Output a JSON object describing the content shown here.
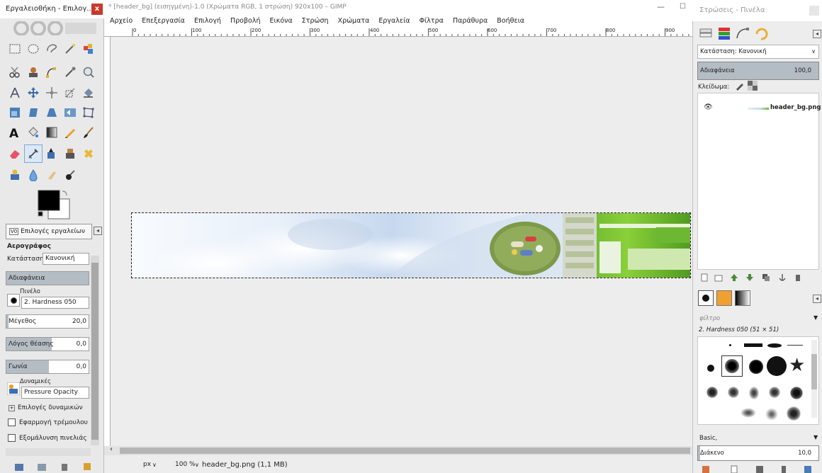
{
  "toolbox": {
    "title": "Εργαλειοθήκη - Επιλογ...",
    "close_label": "x",
    "tool_options_tab": "Επιλογές εργαλείων",
    "tool_name": "Αερογράφος",
    "mode_label": "Κατάσταση:",
    "mode_value": "Κανονική",
    "opacity_label": "Αδιαφάνεια",
    "brush_label": "Πινέλο",
    "brush_value": "2. Hardness 050",
    "size_label": "Μέγεθος",
    "size_value": "20,0",
    "aspect_label": "Λόγος θέασης",
    "aspect_value": "0,0",
    "angle_label": "Γωνία",
    "angle_value": "0,0",
    "dynamics_label": "Δυναμικές",
    "dynamics_value": "Pressure Opacity",
    "dynamics_options": "Επιλογές δυναμικών",
    "apply_jitter": "Εφαρμογή τρέμουλου",
    "smooth_stroke": "Εξομάλυνση πινελιάς"
  },
  "main": {
    "title": "* [header_bg] (εισηγμένη)-1.0 (Χρώματα RGB, 1 στρώση) 920x100 – GIMP",
    "menu": [
      "Αρχείο",
      "Επεξεργασία",
      "Επιλογή",
      "Προβολή",
      "Εικόνα",
      "Στρώση",
      "Χρώματα",
      "Εργαλεία",
      "Φίλτρα",
      "Παράθυρα",
      "Βοήθεια"
    ],
    "ruler_ticks": [
      "0",
      "100",
      "200",
      "300",
      "400",
      "500",
      "600",
      "700",
      "800",
      "900"
    ],
    "status_unit": "px",
    "status_zoom": "100 %",
    "status_file": "header_bg.png (1,1 MB)"
  },
  "dock": {
    "title": "Στρώσεις - Πινέλα",
    "mode_label": "Κατάσταση: Κανονική",
    "opacity_label": "Αδιαφάνεια",
    "opacity_value": "100,0",
    "lock_label": "Κλείδωμα:",
    "layer_name": "header_bg.png",
    "filter_placeholder": "φίλτρο",
    "brush_info": "2. Hardness 050 (51 × 51)",
    "brush_preset": "Basic,",
    "spacing_label": "Διάκενο",
    "spacing_value": "10,0"
  },
  "colors": {
    "foreground": "#000000",
    "background": "#ffffff",
    "accent_green": "#6fc52a"
  }
}
